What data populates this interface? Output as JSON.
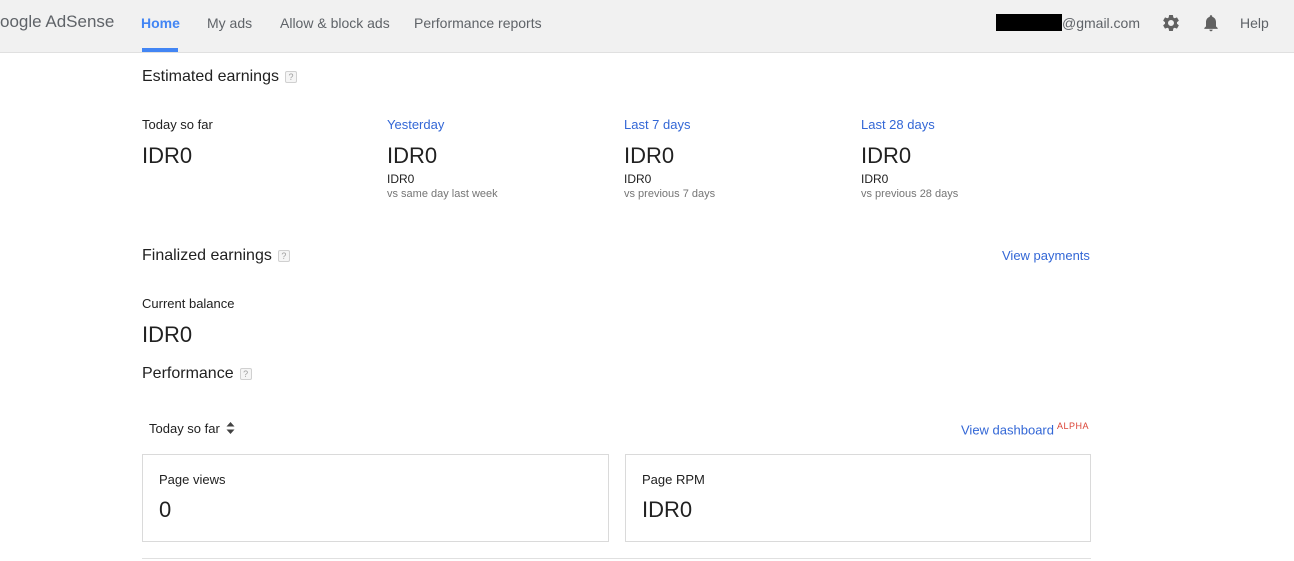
{
  "header": {
    "logo_prefix": "oogle ",
    "logo_product": "AdSense",
    "tabs": [
      {
        "label": "Home"
      },
      {
        "label": "My ads"
      },
      {
        "label": "Allow & block ads"
      },
      {
        "label": "Performance reports"
      }
    ],
    "email_suffix": "@gmail.com",
    "settings_icon": "gear-icon",
    "notifications_icon": "bell-icon",
    "help_label": "Help",
    "accent_color": "#4285f4"
  },
  "estimated": {
    "title": "Estimated earnings",
    "help": "?",
    "periods": [
      {
        "label": "Today so far",
        "value": "IDR0",
        "sub": "",
        "compare": ""
      },
      {
        "label": "Yesterday",
        "value": "IDR0",
        "sub": "IDR0",
        "compare": "vs same day last week"
      },
      {
        "label": "Last 7 days",
        "value": "IDR0",
        "sub": "IDR0",
        "compare": "vs previous 7 days"
      },
      {
        "label": "Last 28 days",
        "value": "IDR0",
        "sub": "IDR0",
        "compare": "vs previous 28 days"
      }
    ]
  },
  "finalized": {
    "title": "Finalized earnings",
    "help": "?",
    "view_payments": "View payments",
    "balance_label": "Current balance",
    "balance_value": "IDR0"
  },
  "performance": {
    "title": "Performance",
    "help": "?",
    "range": "Today so far",
    "view_dashboard": "View dashboard",
    "badge": "ALPHA",
    "cards": [
      {
        "label": "Page views",
        "value": "0"
      },
      {
        "label": "Page RPM",
        "value": "IDR0"
      }
    ]
  }
}
